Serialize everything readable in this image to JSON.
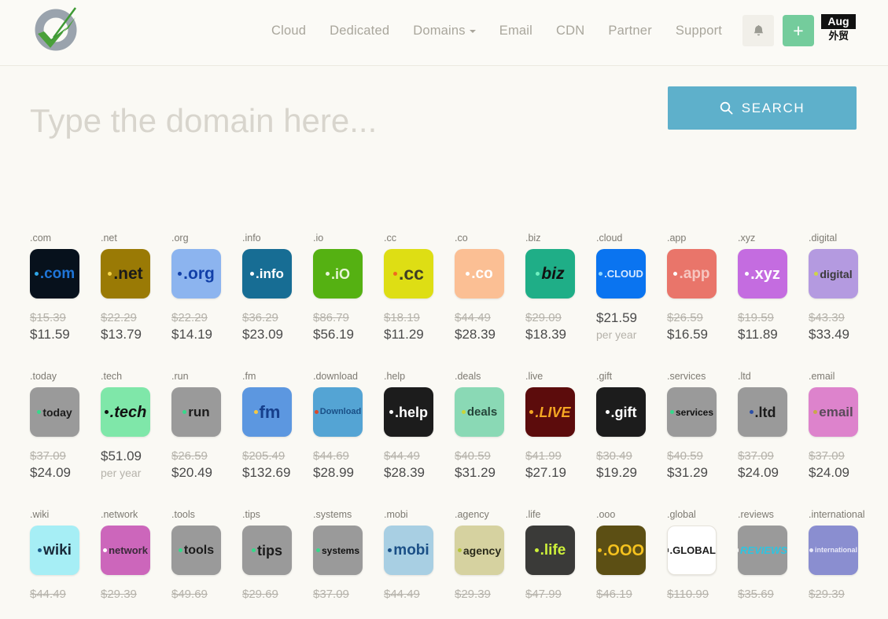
{
  "header": {
    "logo_alt": "logo",
    "nav": [
      {
        "label": "Cloud",
        "dropdown": false
      },
      {
        "label": "Dedicated",
        "dropdown": false
      },
      {
        "label": "Domains",
        "dropdown": true
      },
      {
        "label": "Email",
        "dropdown": false
      },
      {
        "label": "CDN",
        "dropdown": false
      },
      {
        "label": "Partner",
        "dropdown": false
      },
      {
        "label": "Support",
        "dropdown": false
      }
    ],
    "bell_icon": "bell-icon",
    "plus_label": "+",
    "badge_top": "Aug",
    "badge_bottom": "外贸"
  },
  "search": {
    "placeholder": "Type the domain here...",
    "value": "",
    "button_label": "SEARCH",
    "button_icon": "search-icon",
    "button_color": "#5eb0cb"
  },
  "grid": {
    "per_year_label": "per year",
    "cards": [
      {
        "tld": ".com",
        "logo_text": ".com",
        "old": "$15.39",
        "new": "$11.59",
        "bg": "#07111c",
        "fg": "#1f75d8",
        "dot": "#2fa6e8",
        "size": 19,
        "italic": false
      },
      {
        "tld": ".net",
        "logo_text": ".net",
        "old": "$22.29",
        "new": "$13.79",
        "bg": "#9a7a05",
        "fg": "#1a1a1a",
        "dot": "#f5d54a",
        "size": 21,
        "italic": false
      },
      {
        "tld": ".org",
        "logo_text": ".org",
        "old": "$22.29",
        "new": "$14.19",
        "bg": "#8cb4ef",
        "fg": "#113fa8",
        "dot": "#113fa8",
        "size": 21,
        "italic": false
      },
      {
        "tld": ".info",
        "logo_text": ".info",
        "old": "$36.29",
        "new": "$23.09",
        "bg": "#176d94",
        "fg": "#ffffff",
        "dot": "#ffffff",
        "size": 17,
        "italic": false
      },
      {
        "tld": ".io",
        "logo_text": ".iO",
        "old": "$86.79",
        "new": "$56.19",
        "bg": "#55b112",
        "fg": "#e8f5d8",
        "dot": "#e8f5d8",
        "size": 18,
        "italic": false
      },
      {
        "tld": ".cc",
        "logo_text": ".cc",
        "old": "$18.19",
        "new": "$11.29",
        "bg": "#dede14",
        "fg": "#3f3f25",
        "dot": "#f06a1e",
        "size": 23,
        "italic": false
      },
      {
        "tld": ".co",
        "logo_text": ".co",
        "old": "$44.49",
        "new": "$28.39",
        "bg": "#fbbf94",
        "fg": "#ffffff",
        "dot": "#ffffff",
        "size": 19,
        "italic": false
      },
      {
        "tld": ".biz",
        "logo_text": "biz",
        "old": "$29.09",
        "new": "$18.39",
        "bg": "#1fae87",
        "fg": "#111111",
        "dot": "#6ff0c0",
        "size": 21,
        "italic": true
      },
      {
        "tld": ".cloud",
        "logo_text": ".CLOUD",
        "old": "",
        "new": "$21.59",
        "bg": "#0a74f0",
        "fg": "#d6e9ff",
        "dot": "#8fd6ff",
        "size": 13,
        "italic": false,
        "per_year": true
      },
      {
        "tld": ".app",
        "logo_text": ".app",
        "old": "$26.59",
        "new": "$16.59",
        "bg": "#e9756a",
        "fg": "#f6c6c0",
        "dot": "#ffffff",
        "size": 19,
        "italic": false
      },
      {
        "tld": ".xyz",
        "logo_text": ".xyz",
        "old": "$19.59",
        "new": "$11.89",
        "bg": "#c46ce0",
        "fg": "#ffffff",
        "dot": "#ffffff",
        "size": 20,
        "italic": false
      },
      {
        "tld": ".digital",
        "logo_text": "digital",
        "old": "$43.39",
        "new": "$33.49",
        "bg": "#b49ae0",
        "fg": "#3a3a3a",
        "dot": "#cfd447",
        "size": 14,
        "italic": false
      },
      {
        "tld": ".today",
        "logo_text": "today",
        "old": "$37.09",
        "new": "$24.09",
        "bg": "#9a9a9a",
        "fg": "#1c1c1c",
        "dot": "#35d98a",
        "size": 14,
        "italic": false
      },
      {
        "tld": ".tech",
        "logo_text": ".tech",
        "old": "",
        "new": "$51.09",
        "bg": "#7fe7a9",
        "fg": "#111111",
        "dot": "#111111",
        "size": 20,
        "italic": true,
        "per_year": true
      },
      {
        "tld": ".run",
        "logo_text": "run",
        "old": "$26.59",
        "new": "$20.49",
        "bg": "#9a9a9a",
        "fg": "#1c1c1c",
        "dot": "#35d98a",
        "size": 17,
        "italic": false
      },
      {
        "tld": ".fm",
        "logo_text": "fm",
        "old": "$205.49",
        "new": "$132.69",
        "bg": "#5c97e0",
        "fg": "#163f8c",
        "dot": "#f5c842",
        "size": 22,
        "italic": false
      },
      {
        "tld": ".download",
        "logo_text": "Download",
        "old": "$44.69",
        "new": "$28.99",
        "bg": "#54a4d4",
        "fg": "#1a4f86",
        "dot": "#d84a2a",
        "size": 11,
        "italic": false
      },
      {
        "tld": ".help",
        "logo_text": ".help",
        "old": "$44.49",
        "new": "$28.39",
        "bg": "#1c1c1c",
        "fg": "#ffffff",
        "dot": "#ffffff",
        "size": 18,
        "italic": false
      },
      {
        "tld": ".deals",
        "logo_text": "deals",
        "old": "$40.59",
        "new": "$31.29",
        "bg": "#8ad9b5",
        "fg": "#25453a",
        "dot": "#c8d63a",
        "size": 15,
        "italic": false
      },
      {
        "tld": ".live",
        "logo_text": ".LIVE",
        "old": "$41.99",
        "new": "$27.19",
        "bg": "#5c0c0c",
        "fg": "#f5a623",
        "dot": "#f5a623",
        "size": 18,
        "italic": true
      },
      {
        "tld": ".gift",
        "logo_text": ".gift",
        "old": "$30.49",
        "new": "$19.29",
        "bg": "#1c1c1c",
        "fg": "#ffffff",
        "dot": "#ffffff",
        "size": 18,
        "italic": false
      },
      {
        "tld": ".services",
        "logo_text": "services",
        "old": "$40.59",
        "new": "$31.29",
        "bg": "#9a9a9a",
        "fg": "#111111",
        "dot": "#35d98a",
        "size": 12,
        "italic": false
      },
      {
        "tld": ".ltd",
        "logo_text": ".ltd",
        "old": "$37.09",
        "new": "$24.09",
        "bg": "#9a9a9a",
        "fg": "#1c1c1c",
        "dot": "#2b4fa8",
        "size": 18,
        "italic": false
      },
      {
        "tld": ".email",
        "logo_text": "email",
        "old": "$37.09",
        "new": "$24.09",
        "bg": "#dd83cc",
        "fg": "#5a4a5a",
        "dot": "#c9a84a",
        "size": 17,
        "italic": false
      },
      {
        "tld": ".wiki",
        "logo_text": "wiki",
        "old": "$44.49",
        "new": "",
        "bg": "#a6eef5",
        "fg": "#1a2a3a",
        "dot": "#1a5a8a",
        "size": 19,
        "italic": false
      },
      {
        "tld": ".network",
        "logo_text": "network",
        "old": "$29.39",
        "new": "",
        "bg": "#cc66bb",
        "fg": "#3a2a3a",
        "dot": "#ffffff",
        "size": 13,
        "italic": false
      },
      {
        "tld": ".tools",
        "logo_text": "tools",
        "old": "$49.69",
        "new": "",
        "bg": "#9a9a9a",
        "fg": "#1c1c1c",
        "dot": "#35d98a",
        "size": 16,
        "italic": false
      },
      {
        "tld": ".tips",
        "logo_text": "tips",
        "old": "$29.69",
        "new": "",
        "bg": "#9a9a9a",
        "fg": "#1c1c1c",
        "dot": "#35d98a",
        "size": 18,
        "italic": false
      },
      {
        "tld": ".systems",
        "logo_text": "systems",
        "old": "$37.09",
        "new": "",
        "bg": "#9a9a9a",
        "fg": "#111111",
        "dot": "#35d98a",
        "size": 12,
        "italic": false
      },
      {
        "tld": ".mobi",
        "logo_text": "mobi",
        "old": "$44.49",
        "new": "",
        "bg": "#a8cfe3",
        "fg": "#1a4f86",
        "dot": "#1a4f86",
        "size": 19,
        "italic": false
      },
      {
        "tld": ".agency",
        "logo_text": "agency",
        "old": "$29.39",
        "new": "",
        "bg": "#d6d2a0",
        "fg": "#2a2a1a",
        "dot": "#b5c43a",
        "size": 14,
        "italic": false
      },
      {
        "tld": ".life",
        "logo_text": ".life",
        "old": "$47.99",
        "new": "",
        "bg": "#3a3a38",
        "fg": "#cdf03a",
        "dot": "#cdf03a",
        "size": 19,
        "italic": false
      },
      {
        "tld": ".ooo",
        "logo_text": ".OOO",
        "old": "$46.19",
        "new": "",
        "bg": "#5c4f14",
        "fg": "#f5c21e",
        "dot": "#f5c21e",
        "size": 20,
        "italic": false
      },
      {
        "tld": ".global",
        "logo_text": ".GLOBAL",
        "old": "$110.99",
        "new": "",
        "bg": "#ffffff",
        "fg": "#1c1c1c",
        "dot": "#1c1c1c",
        "size": 13,
        "italic": false
      },
      {
        "tld": ".reviews",
        "logo_text": "REVIEWS",
        "old": "$35.69",
        "new": "",
        "bg": "#9a9a9a",
        "fg": "#2ec4e0",
        "dot": "#ffffff",
        "size": 13,
        "italic": true
      },
      {
        "tld": ".international",
        "logo_text": "international",
        "old": "$29.39",
        "new": "",
        "bg": "#8a8ed0",
        "fg": "#e8e8f8",
        "dot": "#e8e8f8",
        "size": 9,
        "italic": false
      }
    ]
  }
}
